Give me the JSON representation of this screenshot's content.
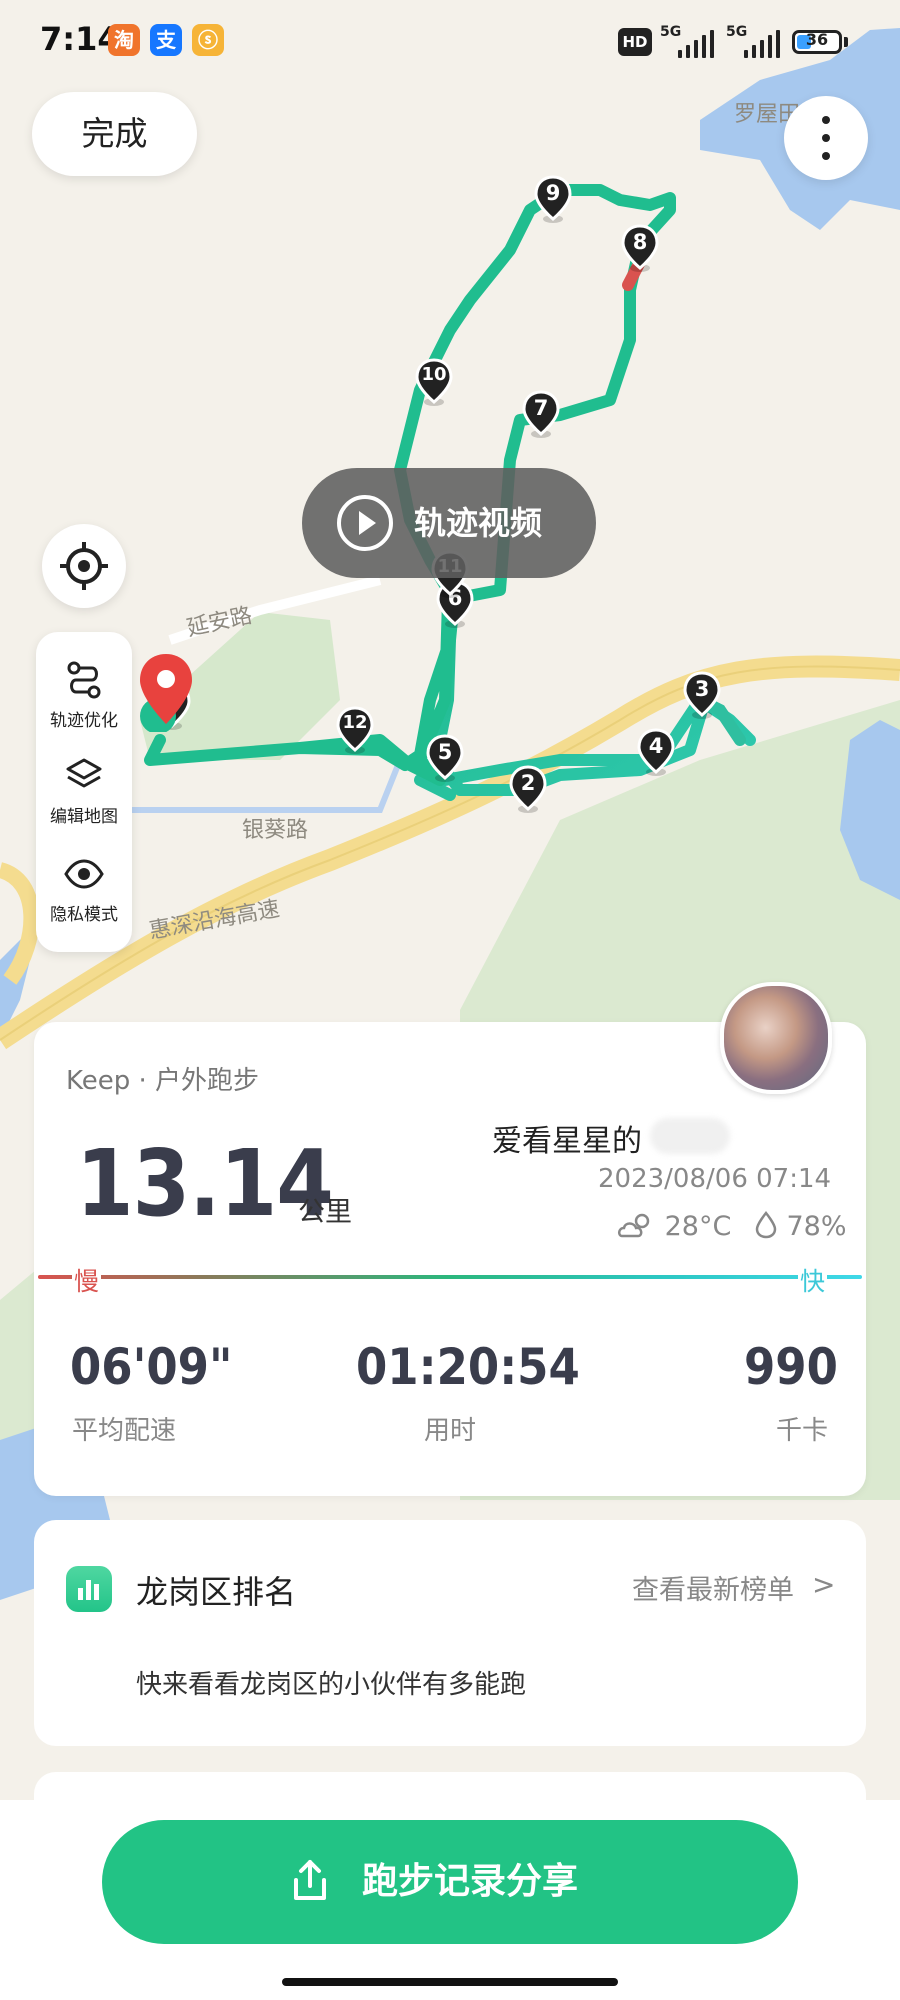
{
  "status_bar": {
    "time": "7:14",
    "app_icons": [
      "淘",
      "支",
      "ⓢ"
    ],
    "hd_label": "HD",
    "signal_labels": [
      "5G",
      "5G"
    ],
    "battery_level": "36",
    "battery_fraction": 0.36
  },
  "map": {
    "done_label": "完成",
    "video_label": "轨迹视频",
    "road_labels": [
      "延安路",
      "银葵路",
      "惠深沿海高速",
      "罗屋田"
    ],
    "tools": [
      {
        "icon": "route-optimize-icon",
        "label": "轨迹优化"
      },
      {
        "icon": "layers-icon",
        "label": "编辑地图"
      },
      {
        "icon": "eye-icon",
        "label": "隐私模式"
      }
    ],
    "km_markers": [
      "2",
      "3",
      "4",
      "5",
      "6",
      "7",
      "8",
      "9",
      "10",
      "11",
      "12",
      "13"
    ],
    "colors": {
      "route_fast": "#3fd8e8",
      "route_mid": "#2bb77d",
      "route_slow": "#d9534f",
      "pin": "#e8423e"
    }
  },
  "summary": {
    "source": "Keep · 户外跑步",
    "distance": "13.14",
    "distance_unit": "公里",
    "username": "爱看星星的",
    "datetime": "2023/08/06 07:14",
    "temperature": "28°C",
    "humidity": "78%",
    "slow_label": "慢",
    "fast_label": "快",
    "stats": [
      {
        "value": "06'09\"",
        "label": "平均配速"
      },
      {
        "value": "01:20:54",
        "label": "用时"
      },
      {
        "value": "990",
        "label": "千卡"
      }
    ]
  },
  "ranking": {
    "title": "龙岗区排名",
    "link": "查看最新榜单",
    "chevron": ">",
    "description": "快来看看龙岗区的小伙伴有多能跑"
  },
  "share": {
    "label": "跑步记录分享"
  },
  "colors": {
    "accent": "#22c385",
    "text_dark": "#3a3d4c"
  }
}
